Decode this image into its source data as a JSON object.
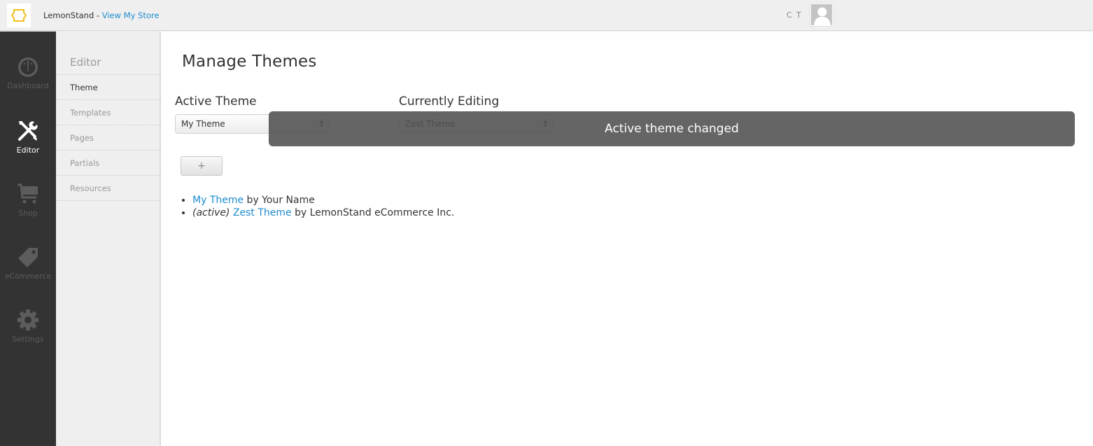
{
  "header": {
    "brand_name": "LemonStand - ",
    "store_link": "View My Store",
    "user_initials": "C T",
    "logo_color": "#f0c020",
    "link_color": "#1e8ccf"
  },
  "nav": {
    "items": [
      {
        "label": "Dashboard",
        "icon": "dashboard-gauge-icon",
        "active": false
      },
      {
        "label": "Editor",
        "icon": "tools-icon",
        "active": true
      },
      {
        "label": "Shop",
        "icon": "cart-icon",
        "active": false
      },
      {
        "label": "eCommerce",
        "icon": "tag-icon",
        "active": false
      },
      {
        "label": "Settings",
        "icon": "gear-icon",
        "active": false
      }
    ]
  },
  "subnav": {
    "title": "Editor",
    "items": [
      {
        "label": "Theme",
        "active": true
      },
      {
        "label": "Templates",
        "active": false
      },
      {
        "label": "Pages",
        "active": false
      },
      {
        "label": "Partials",
        "active": false
      },
      {
        "label": "Resources",
        "active": false
      }
    ]
  },
  "main": {
    "title": "Manage Themes",
    "active_theme_label": "Active Theme",
    "active_theme_value": "My Theme",
    "editing_label": "Currently Editing",
    "editing_value": "Zest Theme",
    "add_button": "+",
    "themes": [
      {
        "prefix": "",
        "name": "My Theme",
        "author": " by Your Name"
      },
      {
        "prefix": "(active)",
        "name": "Zest Theme",
        "author": " by LemonStand eCommerce Inc."
      }
    ]
  },
  "toast": {
    "message": "Active theme changed"
  }
}
